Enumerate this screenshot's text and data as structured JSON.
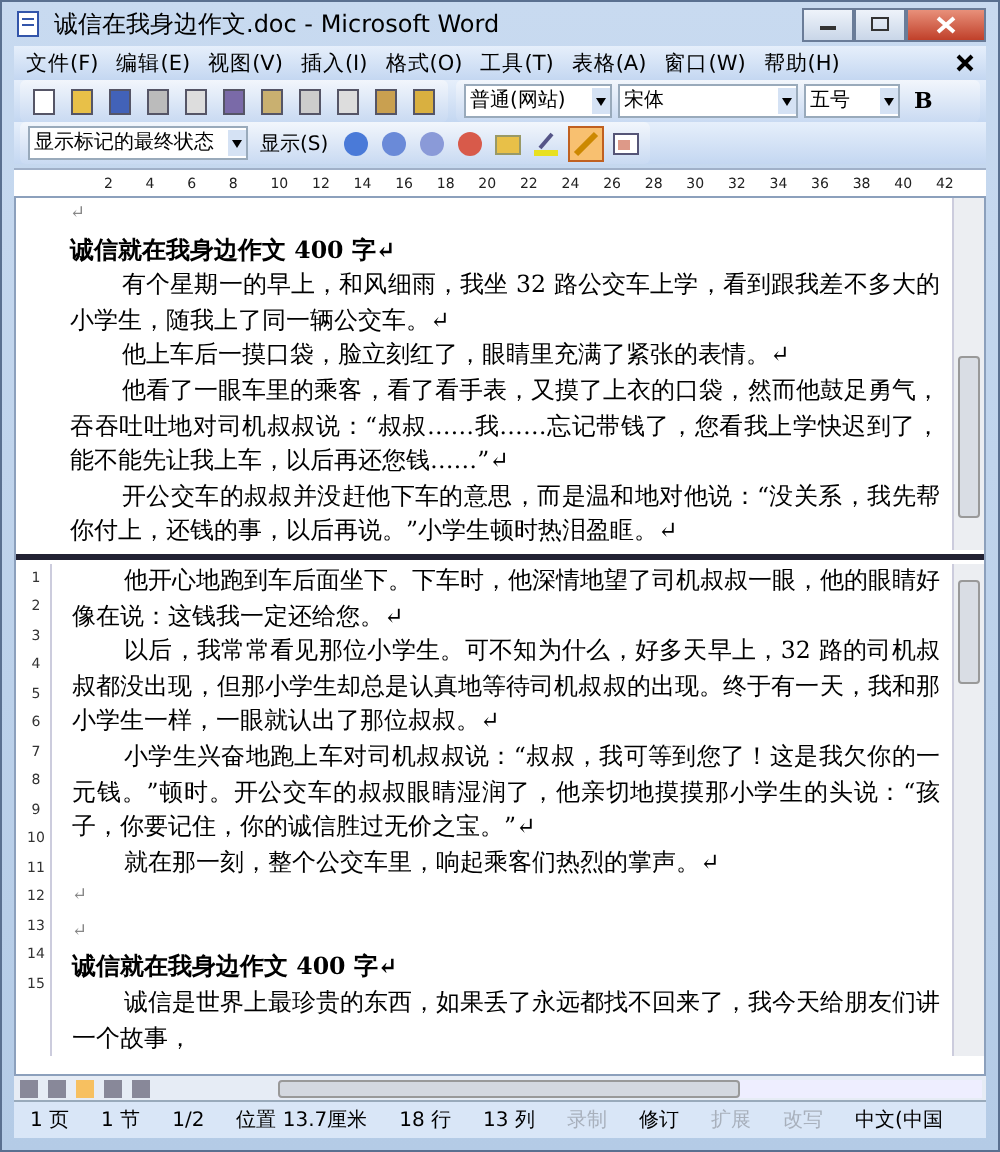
{
  "window": {
    "title": "诚信在我身边作文.doc - Microsoft Word"
  },
  "menu": [
    "文件(F)",
    "编辑(E)",
    "视图(V)",
    "插入(I)",
    "格式(O)",
    "工具(T)",
    "表格(A)",
    "窗口(W)",
    "帮助(H)"
  ],
  "formatting": {
    "style": "普通(网站)",
    "font": "宋体",
    "size": "五号",
    "bold": "B"
  },
  "reviewing": {
    "display": "显示标记的最终状态",
    "show": "显示(S)",
    "markup_on": true
  },
  "ruler": [
    "2",
    "4",
    "6",
    "8",
    "10",
    "12",
    "14",
    "16",
    "18",
    "20",
    "22",
    "24",
    "26",
    "28",
    "30",
    "32",
    "34",
    "36",
    "38",
    "40",
    "42"
  ],
  "vertical_ruler": [
    "1",
    "2",
    "3",
    "4",
    "5",
    "6",
    "7",
    "8",
    "9",
    "10",
    "11",
    "12",
    "13",
    "14",
    "15"
  ],
  "document": {
    "top_pane": [
      {
        "kind": "empty",
        "text": "↵"
      },
      {
        "kind": "heading",
        "text": "诚信就在我身边作文 400 字↵"
      },
      {
        "kind": "body",
        "text": "有个星期一的早上，和风细雨，我坐 32 路公交车上学，看到跟我差不多大的小学生，随我上了同一辆公交车。↵"
      },
      {
        "kind": "body",
        "text": "他上车后一摸口袋，脸立刻红了，眼睛里充满了紧张的表情。↵"
      },
      {
        "kind": "body",
        "text": "他看了一眼车里的乘客，看了看手表，又摸了上衣的口袋，然而他鼓足勇气，吞吞吐吐地对司机叔叔说：“叔叔……我……忘记带钱了，您看我上学快迟到了，能不能先让我上车，以后再还您钱……”↵"
      },
      {
        "kind": "body",
        "text": "开公交车的叔叔并没赶他下车的意思，而是温和地对他说：“没关系，我先帮你付上，还钱的事，以后再说。”小学生顿时热泪盈眶。↵"
      }
    ],
    "bottom_pane": [
      {
        "kind": "body",
        "text": "他开心地跑到车后面坐下。下车时，他深情地望了司机叔叔一眼，他的眼睛好像在说：这钱我一定还给您。↵"
      },
      {
        "kind": "body",
        "text": "以后，我常常看见那位小学生。可不知为什么，好多天早上，32 路的司机叔叔都没出现，但那小学生却总是认真地等待司机叔叔的出现。终于有一天，我和那小学生一样，一眼就认出了那位叔叔。↵"
      },
      {
        "kind": "body",
        "text": "小学生兴奋地跑上车对司机叔叔说：“叔叔，我可等到您了！这是我欠你的一元钱。”顿时。开公交车的叔叔眼睛湿润了，他亲切地摸摸那小学生的头说：“孩子，你要记住，你的诚信胜过无价之宝。”↵"
      },
      {
        "kind": "body",
        "text": "就在那一刻，整个公交车里，响起乘客们热烈的掌声。↵"
      },
      {
        "kind": "empty",
        "text": "↵"
      },
      {
        "kind": "empty",
        "text": "↵"
      },
      {
        "kind": "heading",
        "text": "诚信就在我身边作文 400 字↵"
      },
      {
        "kind": "body",
        "text": "诚信是世界上最珍贵的东西，如果丢了永远都找不回来了，我今天给朋友们讲一个故事，"
      }
    ]
  },
  "status_bar": [
    {
      "text": "1 页",
      "disabled": false
    },
    {
      "text": "1 节",
      "disabled": false
    },
    {
      "text": "1/2",
      "disabled": false
    },
    {
      "text": "位置 13.7厘米",
      "disabled": false
    },
    {
      "text": "18 行",
      "disabled": false
    },
    {
      "text": "13 列",
      "disabled": false
    },
    {
      "text": "录制",
      "disabled": true
    },
    {
      "text": "修订",
      "disabled": false
    },
    {
      "text": "扩展",
      "disabled": true
    },
    {
      "text": "改写",
      "disabled": true
    },
    {
      "text": "中文(中国",
      "disabled": false
    }
  ]
}
